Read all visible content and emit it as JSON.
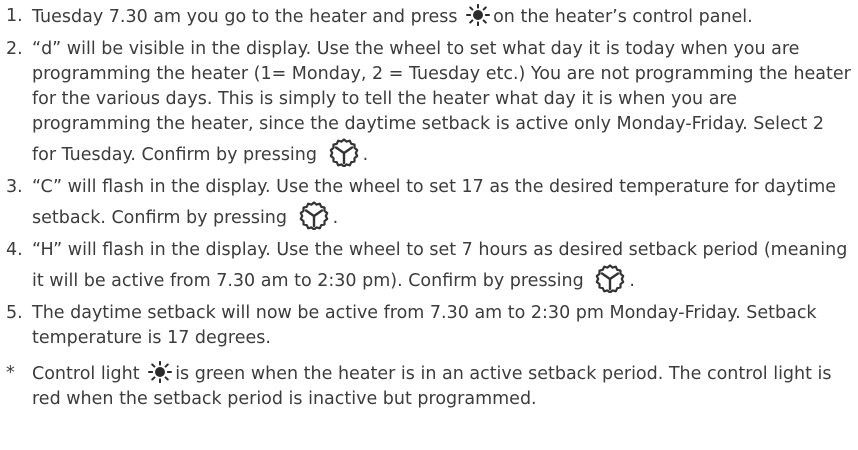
{
  "icons": {
    "sun": "sun-icon",
    "confirm": "gear-wheel-icon"
  },
  "steps": [
    {
      "marker": "1.",
      "before": "Tuesday 7.30 am you go to the heater and press",
      "after": "on the heater’s control panel."
    },
    {
      "marker": "2.",
      "before": "“d” will be visible in the display. Use the wheel to set what day it is today when you are programming the heater (1= Monday, 2 = Tuesday etc.) You are not programming the heater for the various days. This is simply to tell the heater what day it is when you are programming the heater, since the daytime setback is active only Monday-Friday. Select 2 for Tuesday. Confirm by pressing",
      "after": "."
    },
    {
      "marker": "3.",
      "before": "“C” will flash in the display. Use the wheel to set 17 as the desired temperature for daytime setback. Confirm by pressing",
      "after": "."
    },
    {
      "marker": "4.",
      "before": "“H” will flash in the display. Use the wheel to set 7 hours as desired setback period (meaning it will be active from 7.30 am to 2:30 pm). Confirm by pressing",
      "after": "."
    },
    {
      "marker": "5.",
      "text": "The daytime setback will now be active from 7.30 am to 2:30 pm Monday-Friday. Setback temperature is 17 degrees."
    }
  ],
  "note": {
    "marker": "*",
    "before": "Control light",
    "after": "is green when the heater is in an active setback period. The control light is red when the setback period is inactive but programmed."
  }
}
